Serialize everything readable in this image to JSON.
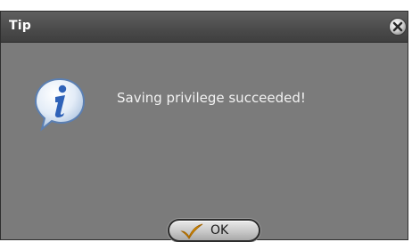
{
  "dialog": {
    "title": "Tip",
    "message": "Saving privilege succeeded!",
    "ok_label": "OK"
  },
  "icons": {
    "close": "close-icon",
    "info": "info-icon",
    "check": "checkmark-icon"
  },
  "colors": {
    "titlebar": "#4a4a4a",
    "body": "#7b7b7b",
    "text": "#f2f2f2",
    "icon_blue": "#2f62b8"
  }
}
